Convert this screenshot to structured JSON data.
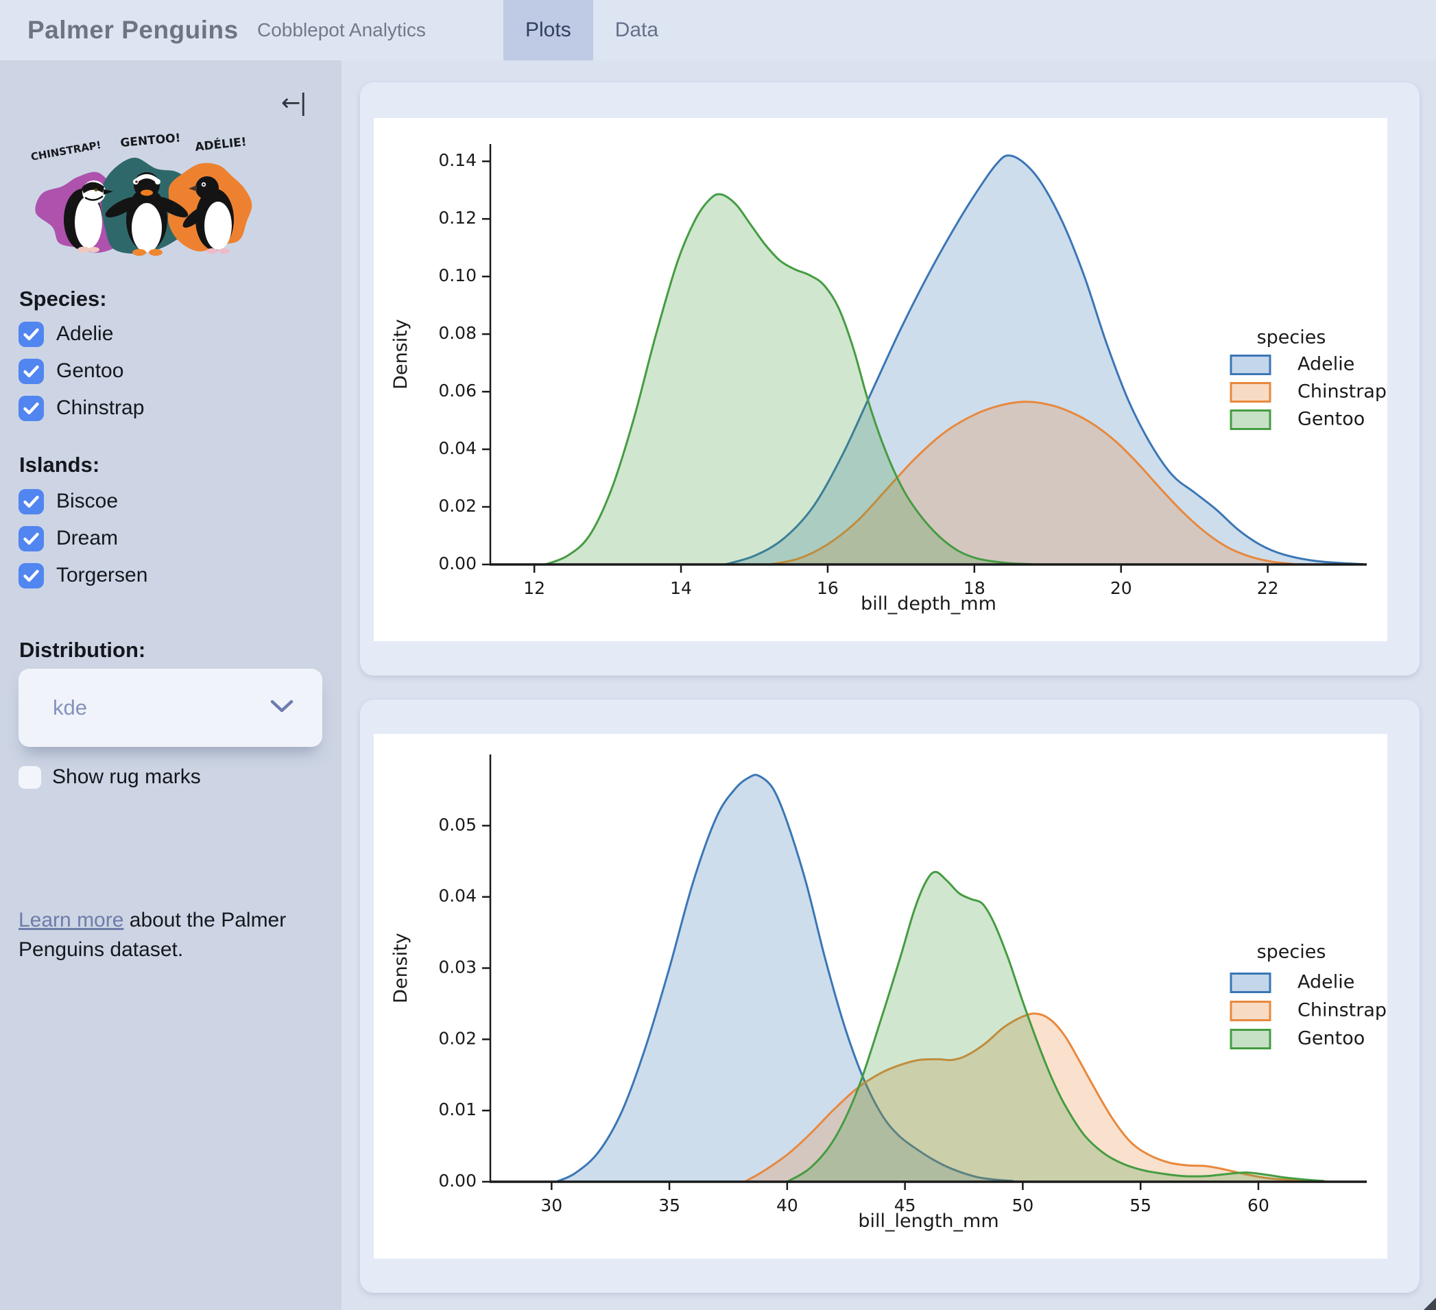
{
  "header": {
    "title": "Palmer Penguins",
    "subtitle": "Cobblepot Analytics",
    "tabs": [
      {
        "label": "Plots",
        "active": true
      },
      {
        "label": "Data",
        "active": false
      }
    ]
  },
  "sidebar": {
    "collapse_icon": "←|",
    "artwork": {
      "labels": [
        "CHINSTRAP!",
        "GENTOO!",
        "ADÉLIE!"
      ],
      "splash_colors": {
        "chinstrap": "#ae52ae",
        "gentoo": "#2e686a",
        "adelie": "#ee8130"
      }
    },
    "species": {
      "label": "Species:",
      "options": [
        {
          "label": "Adelie",
          "checked": true
        },
        {
          "label": "Gentoo",
          "checked": true
        },
        {
          "label": "Chinstrap",
          "checked": true
        }
      ]
    },
    "islands": {
      "label": "Islands:",
      "options": [
        {
          "label": "Biscoe",
          "checked": true
        },
        {
          "label": "Dream",
          "checked": true
        },
        {
          "label": "Torgersen",
          "checked": true
        }
      ]
    },
    "distribution": {
      "label": "Distribution:",
      "value": "kde"
    },
    "rug": {
      "label": "Show rug marks",
      "checked": false
    },
    "footer": {
      "link_text": "Learn more",
      "text_after": " about the Palmer Penguins dataset."
    }
  },
  "colors": {
    "checkbox_accent": "#5185f0",
    "link": "#6e7ca9",
    "tab_active_bg": "#bfcbe4",
    "series": {
      "Adelie": "#3a76b5",
      "Chinstrap": "#e8883c",
      "Gentoo": "#459c41"
    }
  },
  "chart_data": [
    {
      "type": "area",
      "name": "kde-bill-depth",
      "title": "",
      "xlabel": "bill_depth_mm",
      "ylabel": "Density",
      "xlim": [
        11.4,
        23.35
      ],
      "ylim": [
        0,
        0.146
      ],
      "grid": false,
      "legend_title": "species",
      "legend_position": "right",
      "xticks": [
        {
          "v": 12,
          "label": "12"
        },
        {
          "v": 14,
          "label": "14"
        },
        {
          "v": 16,
          "label": "16"
        },
        {
          "v": 18,
          "label": "18"
        },
        {
          "v": 20,
          "label": "20"
        },
        {
          "v": 22,
          "label": "22"
        }
      ],
      "yticks": [
        {
          "v": 0,
          "label": "0.00"
        },
        {
          "v": 0.02,
          "label": "0.02"
        },
        {
          "v": 0.04,
          "label": "0.04"
        },
        {
          "v": 0.06,
          "label": "0.06"
        },
        {
          "v": 0.08,
          "label": "0.08"
        },
        {
          "v": 0.1,
          "label": "0.10"
        },
        {
          "v": 0.12,
          "label": "0.12"
        },
        {
          "v": 0.14,
          "label": "0.14"
        }
      ],
      "series": [
        {
          "name": "Adelie",
          "color": "#3a76b5",
          "points": [
            [
              14.6,
              0
            ],
            [
              15.0,
              0.003
            ],
            [
              15.4,
              0.009
            ],
            [
              15.8,
              0.02
            ],
            [
              16.2,
              0.038
            ],
            [
              16.6,
              0.06
            ],
            [
              17.0,
              0.082
            ],
            [
              17.4,
              0.102
            ],
            [
              17.8,
              0.12
            ],
            [
              18.1,
              0.132
            ],
            [
              18.3,
              0.139
            ],
            [
              18.45,
              0.142
            ],
            [
              18.65,
              0.14
            ],
            [
              18.9,
              0.133
            ],
            [
              19.2,
              0.119
            ],
            [
              19.5,
              0.1
            ],
            [
              19.8,
              0.077
            ],
            [
              20.1,
              0.057
            ],
            [
              20.4,
              0.042
            ],
            [
              20.7,
              0.031
            ],
            [
              21.0,
              0.025
            ],
            [
              21.3,
              0.019
            ],
            [
              21.6,
              0.012
            ],
            [
              21.9,
              0.0068
            ],
            [
              22.2,
              0.0036
            ],
            [
              22.6,
              0.0014
            ],
            [
              23.0,
              0.0005
            ],
            [
              23.3,
              0.0001
            ]
          ]
        },
        {
          "name": "Chinstrap",
          "color": "#e8883c",
          "points": [
            [
              15.2,
              0
            ],
            [
              15.6,
              0.002
            ],
            [
              16.0,
              0.007
            ],
            [
              16.4,
              0.015
            ],
            [
              16.8,
              0.026
            ],
            [
              17.2,
              0.037
            ],
            [
              17.6,
              0.046
            ],
            [
              18.0,
              0.052
            ],
            [
              18.35,
              0.0552
            ],
            [
              18.7,
              0.0565
            ],
            [
              19.05,
              0.0553
            ],
            [
              19.35,
              0.0525
            ],
            [
              19.65,
              0.0482
            ],
            [
              19.95,
              0.0422
            ],
            [
              20.25,
              0.0345
            ],
            [
              20.55,
              0.026
            ],
            [
              20.85,
              0.018
            ],
            [
              21.15,
              0.0112
            ],
            [
              21.45,
              0.006
            ],
            [
              21.75,
              0.0028
            ],
            [
              22.05,
              0.001
            ],
            [
              22.35,
              0.0002
            ]
          ]
        },
        {
          "name": "Gentoo",
          "color": "#459c41",
          "points": [
            [
              12.15,
              0
            ],
            [
              12.45,
              0.003
            ],
            [
              12.75,
              0.01
            ],
            [
              13.05,
              0.026
            ],
            [
              13.35,
              0.05
            ],
            [
              13.65,
              0.079
            ],
            [
              13.95,
              0.105
            ],
            [
              14.2,
              0.12
            ],
            [
              14.4,
              0.127
            ],
            [
              14.55,
              0.1285
            ],
            [
              14.75,
              0.125
            ],
            [
              14.95,
              0.118
            ],
            [
              15.15,
              0.111
            ],
            [
              15.35,
              0.1055
            ],
            [
              15.55,
              0.1025
            ],
            [
              15.75,
              0.1005
            ],
            [
              15.95,
              0.097
            ],
            [
              16.15,
              0.089
            ],
            [
              16.35,
              0.075
            ],
            [
              16.55,
              0.057
            ],
            [
              16.75,
              0.042
            ],
            [
              16.95,
              0.03
            ],
            [
              17.15,
              0.021
            ],
            [
              17.45,
              0.0115
            ],
            [
              17.75,
              0.0052
            ],
            [
              18.05,
              0.002
            ],
            [
              18.45,
              0.0005
            ],
            [
              18.8,
              0.0001
            ]
          ]
        }
      ]
    },
    {
      "type": "area",
      "name": "kde-bill-length",
      "title": "",
      "xlabel": "bill_length_mm",
      "ylabel": "Density",
      "xlim": [
        27.4,
        64.6
      ],
      "ylim": [
        0,
        0.06
      ],
      "grid": false,
      "legend_title": "species",
      "legend_position": "right",
      "xticks": [
        {
          "v": 30,
          "label": "30"
        },
        {
          "v": 35,
          "label": "35"
        },
        {
          "v": 40,
          "label": "40"
        },
        {
          "v": 45,
          "label": "45"
        },
        {
          "v": 50,
          "label": "50"
        },
        {
          "v": 55,
          "label": "55"
        },
        {
          "v": 60,
          "label": "60"
        }
      ],
      "yticks": [
        {
          "v": 0,
          "label": "0.00"
        },
        {
          "v": 0.01,
          "label": "0.01"
        },
        {
          "v": 0.02,
          "label": "0.02"
        },
        {
          "v": 0.03,
          "label": "0.03"
        },
        {
          "v": 0.04,
          "label": "0.04"
        },
        {
          "v": 0.05,
          "label": "0.05"
        }
      ],
      "series": [
        {
          "name": "Adelie",
          "color": "#3a76b5",
          "points": [
            [
              30.2,
              0
            ],
            [
              31,
              0.0012
            ],
            [
              32,
              0.0042
            ],
            [
              33,
              0.01
            ],
            [
              34,
              0.019
            ],
            [
              35,
              0.03
            ],
            [
              36,
              0.042
            ],
            [
              37,
              0.0512
            ],
            [
              37.8,
              0.0552
            ],
            [
              38.4,
              0.0568
            ],
            [
              38.8,
              0.057
            ],
            [
              39.4,
              0.0552
            ],
            [
              40,
              0.0505
            ],
            [
              40.8,
              0.042
            ],
            [
              41.6,
              0.0315
            ],
            [
              42.4,
              0.0222
            ],
            [
              43.2,
              0.0148
            ],
            [
              44,
              0.0095
            ],
            [
              44.7,
              0.0066
            ],
            [
              45.4,
              0.0048
            ],
            [
              46.2,
              0.0031
            ],
            [
              47,
              0.0018
            ],
            [
              48,
              0.0007
            ],
            [
              48.8,
              0.0003
            ],
            [
              49.6,
              0.0001
            ]
          ]
        },
        {
          "name": "Chinstrap",
          "color": "#e8883c",
          "points": [
            [
              38.2,
              0
            ],
            [
              39,
              0.0015
            ],
            [
              40,
              0.0038
            ],
            [
              41,
              0.0068
            ],
            [
              42,
              0.0102
            ],
            [
              43,
              0.0132
            ],
            [
              44,
              0.0153
            ],
            [
              44.8,
              0.0164
            ],
            [
              45.6,
              0.0171
            ],
            [
              46.4,
              0.0172
            ],
            [
              47.0,
              0.0171
            ],
            [
              47.6,
              0.0177
            ],
            [
              48.4,
              0.0194
            ],
            [
              49.2,
              0.0217
            ],
            [
              50.0,
              0.0232
            ],
            [
              50.6,
              0.0236
            ],
            [
              51.2,
              0.0227
            ],
            [
              51.8,
              0.0204
            ],
            [
              52.4,
              0.017
            ],
            [
              53.0,
              0.0134
            ],
            [
              53.8,
              0.0089
            ],
            [
              54.6,
              0.0055
            ],
            [
              55.4,
              0.0037
            ],
            [
              56.2,
              0.0027
            ],
            [
              57.0,
              0.0023
            ],
            [
              57.8,
              0.0022
            ],
            [
              58.6,
              0.0017
            ],
            [
              59.4,
              0.0011
            ],
            [
              60.4,
              0.0005
            ],
            [
              61.6,
              0.0002
            ],
            [
              62.8,
              0.0001
            ]
          ]
        },
        {
          "name": "Gentoo",
          "color": "#459c41",
          "points": [
            [
              40.0,
              0
            ],
            [
              41,
              0.002
            ],
            [
              42,
              0.006
            ],
            [
              43,
              0.013
            ],
            [
              44,
              0.023
            ],
            [
              44.8,
              0.0315
            ],
            [
              45.4,
              0.0382
            ],
            [
              45.9,
              0.0422
            ],
            [
              46.3,
              0.0435
            ],
            [
              46.8,
              0.0422
            ],
            [
              47.3,
              0.0405
            ],
            [
              47.8,
              0.0397
            ],
            [
              48.3,
              0.039
            ],
            [
              48.8,
              0.0362
            ],
            [
              49.4,
              0.0312
            ],
            [
              50.0,
              0.0253
            ],
            [
              50.6,
              0.0198
            ],
            [
              51.2,
              0.0148
            ],
            [
              51.8,
              0.0107
            ],
            [
              52.6,
              0.0066
            ],
            [
              53.4,
              0.0041
            ],
            [
              54.2,
              0.0026
            ],
            [
              55.0,
              0.0017
            ],
            [
              55.8,
              0.0012
            ],
            [
              56.8,
              0.0008
            ],
            [
              57.8,
              0.0008
            ],
            [
              58.7,
              0.0011
            ],
            [
              59.5,
              0.0013
            ],
            [
              60.3,
              0.001
            ],
            [
              61.1,
              0.0006
            ],
            [
              62.0,
              0.0003
            ],
            [
              62.8,
              0.0001
            ]
          ]
        }
      ]
    }
  ]
}
